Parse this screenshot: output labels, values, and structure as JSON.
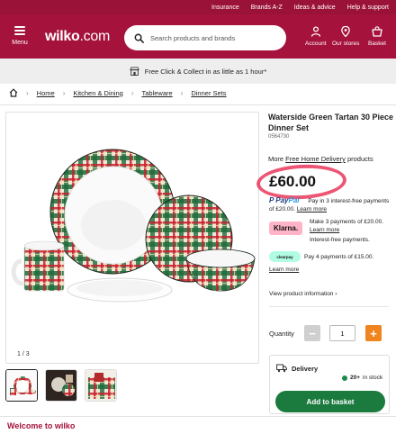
{
  "utility_links": [
    "Insurance",
    "Brands A-Z",
    "Ideas & advice",
    "Help & support"
  ],
  "header": {
    "menu_label": "Menu",
    "logo_text": "wilko",
    "logo_suffix": ".com",
    "search_placeholder": "Search products and brands",
    "account_label": "Account",
    "stores_label": "Our stores",
    "basket_label": "Basket"
  },
  "promo_strip": {
    "text": "Free Click & Collect in as little as 1 hour*",
    "icon": "store-icon"
  },
  "breadcrumb": [
    "Home",
    "Kitchen & Dining",
    "Tableware",
    "Dinner Sets"
  ],
  "product": {
    "title": "Waterside Green Tartan 30 Piece Dinner Set",
    "sku": "0564730",
    "more_free_prefix": "More ",
    "more_free_link": "Free Home Delivery",
    "more_free_suffix": " products",
    "price": "£60.00",
    "paypal": {
      "logo_a": "Pay",
      "logo_b": "Pal",
      "line1": "Pay in 3 interest-free payments",
      "line2": "of £20.00. ",
      "link": "Learn more"
    },
    "klarna": {
      "badge": "Klarna.",
      "line1": "Make 3 payments of £20.00.",
      "link": "Learn more",
      "line3": "Interest-free payments."
    },
    "clearpay": {
      "badge": "clearpay",
      "text": "Pay 4 payments of £15.00.",
      "link": "Learn more"
    },
    "view_info": "View product information ›"
  },
  "gallery": {
    "counter": "1 / 3",
    "thumb_count": 3
  },
  "purchase": {
    "quantity_label": "Quantity",
    "quantity_value": "1",
    "minus": "−",
    "plus": "+",
    "delivery_label": "Delivery",
    "stock_count": "20+",
    "stock_text": "in stock",
    "add_to_basket": "Add to basket"
  },
  "footer": {
    "welcome": "Welcome to wilko"
  },
  "colors": {
    "brand": "#a5123c",
    "cta": "#1b7a3e",
    "accent_plus": "#f0851f",
    "klarna": "#ffb3c7",
    "clearpay": "#b2fce4"
  }
}
